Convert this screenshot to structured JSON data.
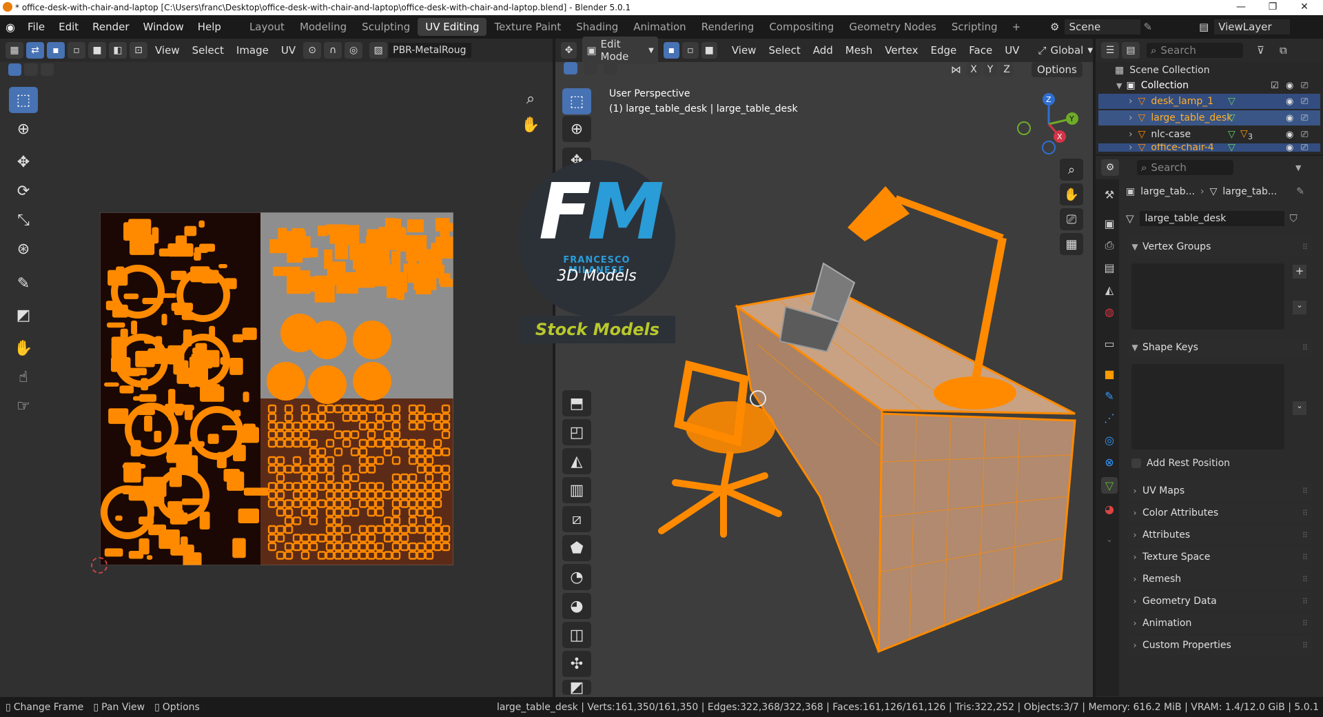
{
  "window": {
    "title": "* office-desk-with-chair-and-laptop [C:\\Users\\franc\\Desktop\\office-desk-with-chair-and-laptop\\office-desk-with-chair-and-laptop.blend] - Blender 5.0.1",
    "minimize": "—",
    "maximize": "❐",
    "close": "✕"
  },
  "menus": [
    "File",
    "Edit",
    "Render",
    "Window",
    "Help"
  ],
  "workspaces": [
    {
      "label": "Layout",
      "active": false
    },
    {
      "label": "Modeling",
      "active": false
    },
    {
      "label": "Sculpting",
      "active": false
    },
    {
      "label": "UV Editing",
      "active": true
    },
    {
      "label": "Texture Paint",
      "active": false
    },
    {
      "label": "Shading",
      "active": false
    },
    {
      "label": "Animation",
      "active": false
    },
    {
      "label": "Rendering",
      "active": false
    },
    {
      "label": "Compositing",
      "active": false
    },
    {
      "label": "Geometry Nodes",
      "active": false
    },
    {
      "label": "Scripting",
      "active": false
    }
  ],
  "add_workspace": "+",
  "scene": {
    "label": "Scene",
    "viewlayer": "ViewLayer"
  },
  "uv_editor": {
    "menus": [
      "View",
      "Select",
      "Image",
      "UV"
    ],
    "image_name": "PBR-MetalRoug"
  },
  "viewport": {
    "mode": "Edit Mode",
    "menus": [
      "View",
      "Select",
      "Add",
      "Mesh",
      "Vertex",
      "Edge",
      "Face",
      "UV"
    ],
    "orientation": "Global",
    "perspective": "User Perspective",
    "object_line": "(1) large_table_desk | large_table_desk",
    "options": "Options",
    "axes": [
      "X",
      "Y",
      "Z"
    ]
  },
  "watermark": {
    "brand": "FRANCESCO MILANESE",
    "subtitle": "3D Models",
    "banner": "Stock Models"
  },
  "outliner": {
    "search_placeholder": "Search",
    "scene_collection": "Scene Collection",
    "collection": "Collection",
    "items": [
      {
        "name": "desk_lamp_1",
        "selected": true,
        "highlight": false
      },
      {
        "name": "large_table_desk",
        "selected": true,
        "highlight": true
      },
      {
        "name": "nlc-case",
        "selected": false,
        "highlight": false,
        "sub": "3"
      },
      {
        "name": "office-chair-4",
        "selected": true,
        "highlight": false
      }
    ]
  },
  "properties": {
    "search_placeholder": "Search",
    "breadcrumb": [
      "large_tab...",
      "large_tab..."
    ],
    "mesh_name": "large_table_desk",
    "sections": {
      "vertex_groups": "Vertex Groups",
      "shape_keys": "Shape Keys",
      "add_rest_position": "Add Rest Position",
      "collapsed": [
        "UV Maps",
        "Color Attributes",
        "Attributes",
        "Texture Space",
        "Remesh",
        "Geometry Data",
        "Animation",
        "Custom Properties"
      ]
    }
  },
  "statusbar": {
    "hints": [
      "Change Frame",
      "Pan View",
      "Options"
    ],
    "stats": "large_table_desk | Verts:161,350/161,350 | Edges:322,368/322,368 | Faces:161,126/161,126 | Tris:322,252 | Objects:3/7 | Memory: 616.2 MiB | VRAM: 1.4/12.0 GiB | 5.0.1"
  },
  "colors": {
    "accent": "#4772b3",
    "mesh_orange": "#ff8a00",
    "bg": "#3d3d3d"
  }
}
